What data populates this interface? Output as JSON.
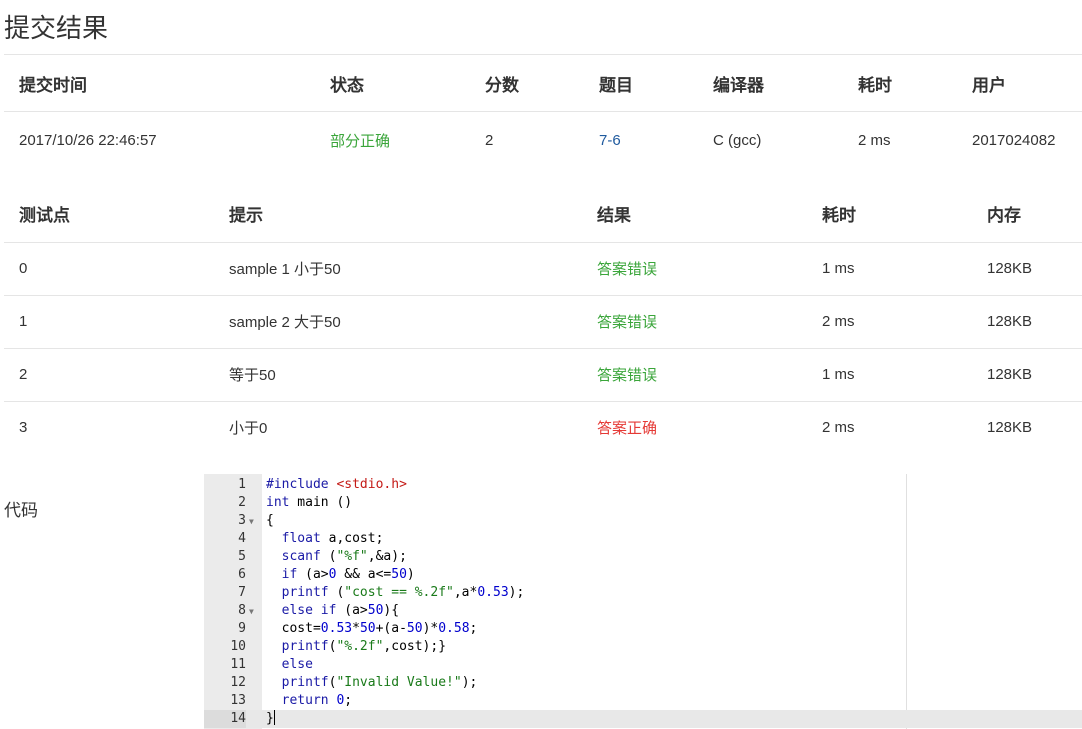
{
  "page": {
    "title": "提交结果",
    "code_label": "代码"
  },
  "summary": {
    "headers": [
      "提交时间",
      "状态",
      "分数",
      "题目",
      "编译器",
      "耗时",
      "用户"
    ],
    "row": {
      "time": "2017/10/26 22:46:57",
      "status": "部分正确",
      "score": "2",
      "problem": "7-6",
      "compiler": "C (gcc)",
      "elapsed": "2 ms",
      "user": "2017024082"
    }
  },
  "cases": {
    "headers": [
      "测试点",
      "提示",
      "结果",
      "耗时",
      "内存"
    ],
    "rows": [
      {
        "id": "0",
        "hint": "sample 1 小于50",
        "result": "答案错误",
        "time": "1 ms",
        "memory": "128KB"
      },
      {
        "id": "1",
        "hint": "sample 2 大于50",
        "result": "答案错误",
        "time": "2 ms",
        "memory": "128KB"
      },
      {
        "id": "2",
        "hint": "等于50",
        "result": "答案错误",
        "time": "1 ms",
        "memory": "128KB"
      },
      {
        "id": "3",
        "hint": "小于0",
        "result": "答案正确",
        "time": "2 ms",
        "memory": "128KB"
      }
    ]
  },
  "colors": {
    "wrong": "#3aa53a",
    "correct": "#e53935",
    "link": "#1f5a9e"
  },
  "code": {
    "active_line": 14,
    "lines": [
      {
        "n": "1",
        "fold": "",
        "text": "#include <stdio.h>"
      },
      {
        "n": "2",
        "fold": "",
        "text": "int main ()"
      },
      {
        "n": "3",
        "fold": "▼",
        "text": "{"
      },
      {
        "n": "4",
        "fold": "",
        "text": "  float a,cost;"
      },
      {
        "n": "5",
        "fold": "",
        "text": "  scanf (\"%f\",&a);"
      },
      {
        "n": "6",
        "fold": "",
        "text": "  if (a>0 && a<=50)"
      },
      {
        "n": "7",
        "fold": "",
        "text": "  printf (\"cost == %.2f\",a*0.53);"
      },
      {
        "n": "8",
        "fold": "▼",
        "text": "  else if (a>50){"
      },
      {
        "n": "9",
        "fold": "",
        "text": "  cost=0.53*50+(a-50)*0.58;"
      },
      {
        "n": "10",
        "fold": "",
        "text": "  printf(\"%.2f\",cost);}"
      },
      {
        "n": "11",
        "fold": "",
        "text": "  else"
      },
      {
        "n": "12",
        "fold": "",
        "text": "  printf(\"Invalid Value!\");"
      },
      {
        "n": "13",
        "fold": "",
        "text": "  return 0;"
      },
      {
        "n": "14",
        "fold": "",
        "text": "}"
      }
    ]
  }
}
